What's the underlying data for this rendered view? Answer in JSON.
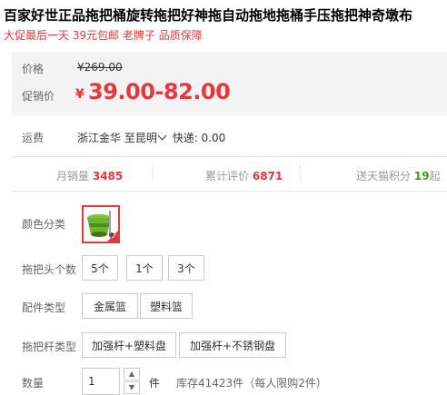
{
  "product": {
    "title": "百家好世正品拖把桶旋转拖把好神拖自动拖地拖桶手压拖把神奇墩布",
    "promo_line": "大促最后一天 39元包邮 老牌子 品质保障"
  },
  "price": {
    "original_label": "价格",
    "original_price": "¥269.00",
    "promo_label": "促销价",
    "currency": "¥",
    "promo_price": "39.00-82.00"
  },
  "shipping": {
    "label": "运费",
    "origin": "浙江金华",
    "destination": "至昆明",
    "method": "快递: 0.00"
  },
  "stats": {
    "monthly_sales_label": "月销量",
    "monthly_sales": "3485",
    "reviews_label": "累计评价",
    "reviews": "6871",
    "points_label": "送天猫积分",
    "points": "19",
    "points_suffix": "起"
  },
  "options": {
    "color_label": "颜色分类",
    "mop_head_label": "拖把头个数",
    "mop_head_values": [
      "5个",
      "1个",
      "3个"
    ],
    "accessory_label": "配件类型",
    "accessory_values": [
      "金属篮",
      "塑料篮"
    ],
    "rod_label": "拖把杆类型",
    "rod_values": [
      "加强杆+塑料盘",
      "加强杆+不锈钢盘"
    ]
  },
  "quantity": {
    "label": "数量",
    "value": "1",
    "unit": "件",
    "stock": "库存41423件",
    "limit": "（每人限购2件）"
  },
  "colors": {
    "accent": "#e4393c",
    "points_green": "#3b9e17",
    "price_bg": "#f3f3f3"
  }
}
